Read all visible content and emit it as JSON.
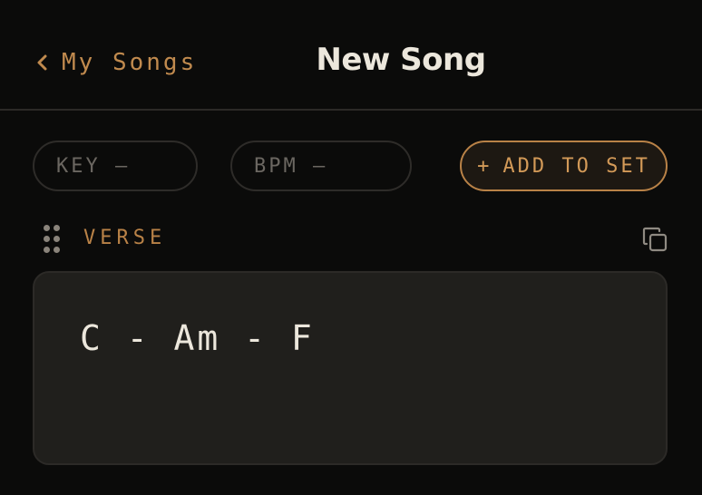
{
  "header": {
    "back_label": "My Songs",
    "back_icon": "chevron-left-icon",
    "title": "New Song"
  },
  "meta": {
    "key_placeholder": "KEY –",
    "bpm_placeholder": "BPM –"
  },
  "actions": {
    "add_to_set_plus": "+",
    "add_to_set_label": "ADD TO SET"
  },
  "section": {
    "label": "VERSE",
    "drag_icon": "drag-handle-icon",
    "copy_icon": "copy-icon",
    "chords": "C - Am - F"
  },
  "colors": {
    "background": "#0b0b0a",
    "accent": "#c08a4e",
    "card": "#201f1c",
    "text": "#ece7dc"
  }
}
